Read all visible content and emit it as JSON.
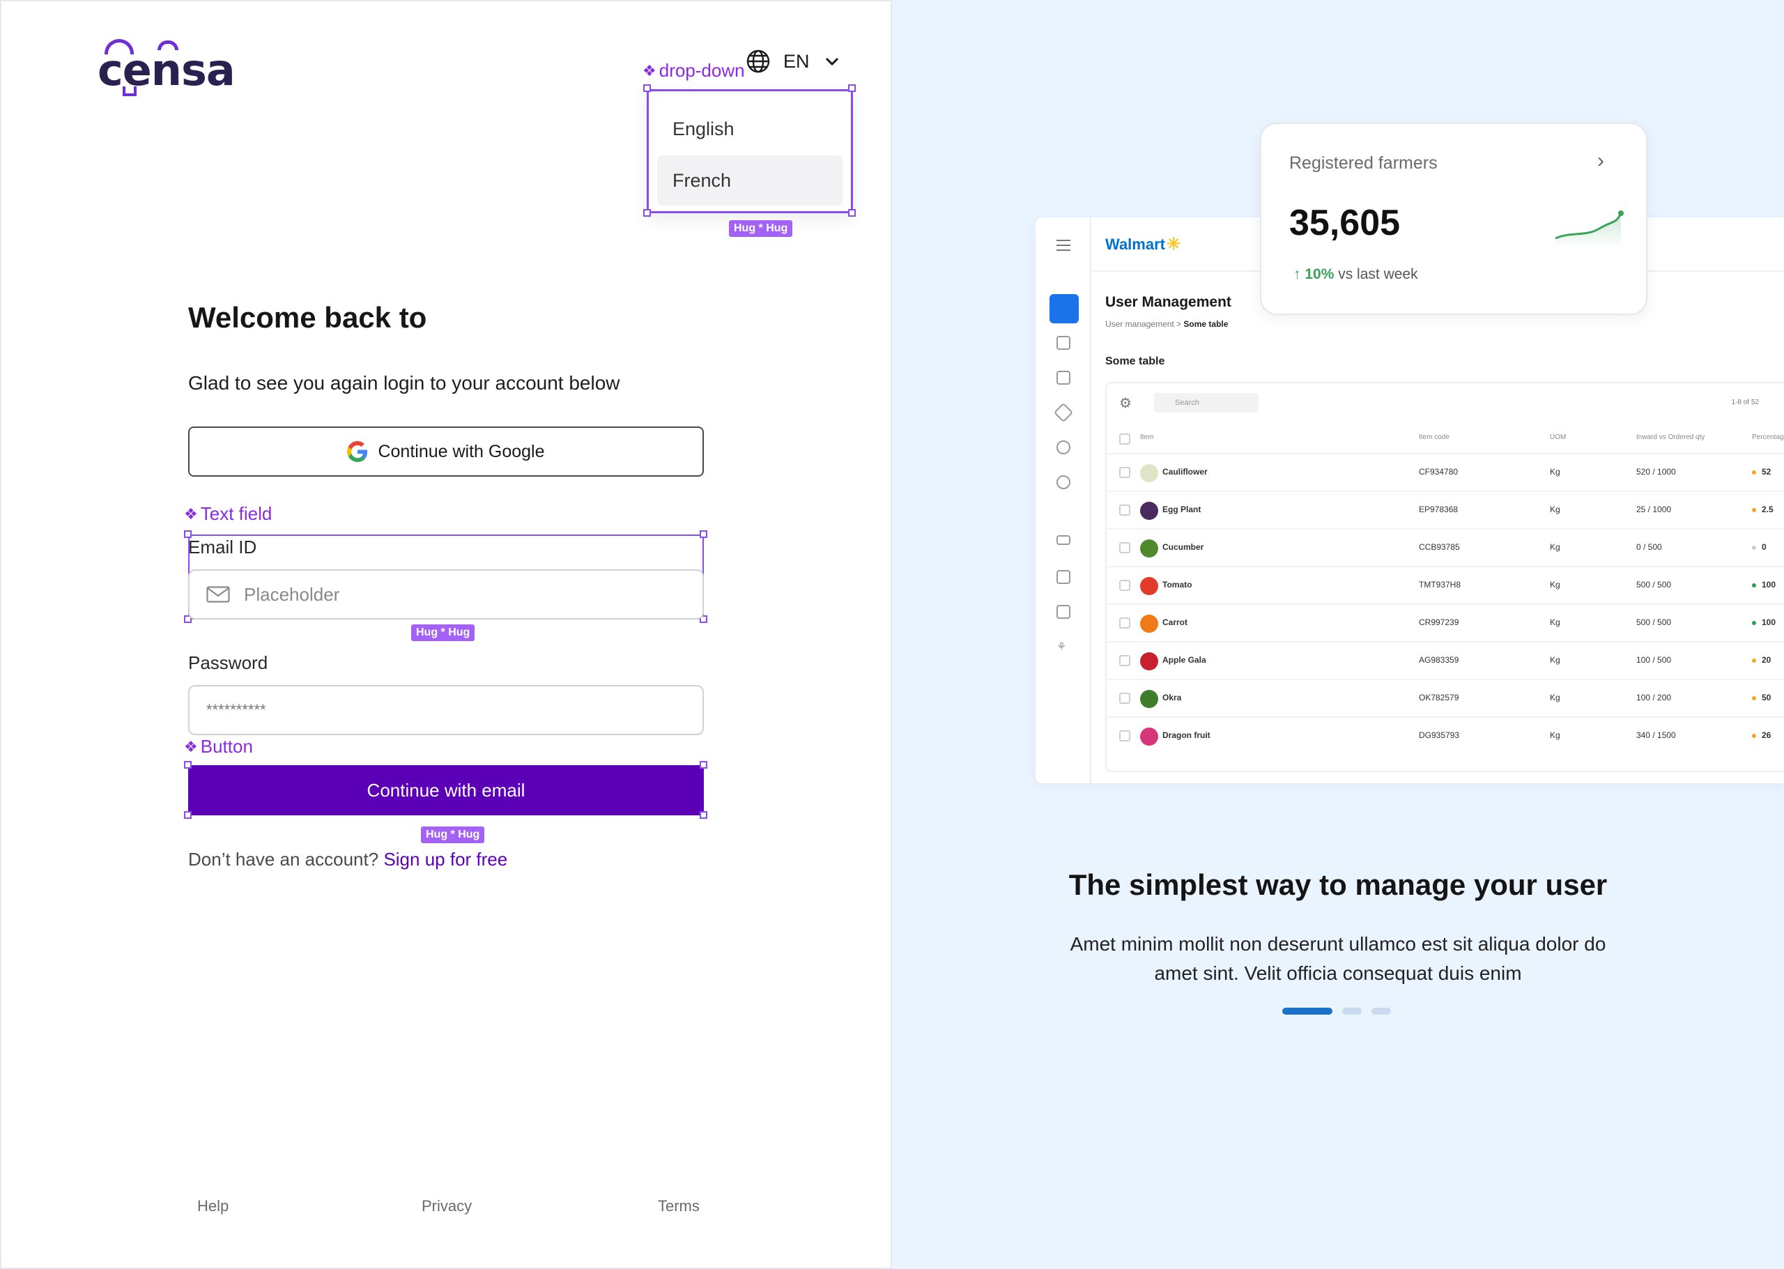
{
  "brand": {
    "logo_text": "censa"
  },
  "language": {
    "current": "EN",
    "component_label": "drop-down",
    "options": [
      "English",
      "French"
    ],
    "selected": "French",
    "hug_tag": "Hug * Hug"
  },
  "form": {
    "welcome": "Welcome back to",
    "subtitle": "Glad to see you again login to your account below",
    "google_button": "Continue with Google",
    "text_field_component": "Text field",
    "email_label": "Email ID",
    "email_placeholder": "Placeholder",
    "email_hug_tag": "Hug * Hug",
    "password_label": "Password",
    "password_value": "**********",
    "button_component": "Button",
    "submit_button": "Continue with email",
    "button_hug_tag": "Hug * Hug",
    "signup_prompt": "Don’t have an account?",
    "signup_link": "Sign up for free"
  },
  "footer": {
    "help": "Help",
    "privacy": "Privacy",
    "terms": "Terms"
  },
  "preview": {
    "brand": "Walmart",
    "page_title": "User Management",
    "breadcrumb_root": "User management >",
    "breadcrumb_current": "Some table",
    "table_title": "Some table",
    "search_placeholder": "Search",
    "pager": "1-8 of 52",
    "columns": [
      "Item",
      "Item code",
      "UOM",
      "Inward vs Ordered qty",
      "Percentag"
    ],
    "rows": [
      {
        "item": "Cauliflower",
        "code": "CF934780",
        "uom": "Kg",
        "qty": "520 / 1000",
        "pct": "52",
        "status": "#f5a623",
        "thumb": "#dfe6c8"
      },
      {
        "item": "Egg Plant",
        "code": "EP978368",
        "uom": "Kg",
        "qty": "25 / 1000",
        "pct": "2.5",
        "status": "#f5a623",
        "thumb": "#4a2b5e"
      },
      {
        "item": "Cucumber",
        "code": "CCB93785",
        "uom": "Kg",
        "qty": "0 / 500",
        "pct": "0",
        "status": "#cccccc",
        "thumb": "#4f8a2c"
      },
      {
        "item": "Tomato",
        "code": "TMT937H8",
        "uom": "Kg",
        "qty": "500 / 500",
        "pct": "100",
        "status": "#2e9e4f",
        "thumb": "#e23b2a"
      },
      {
        "item": "Carrot",
        "code": "CR997239",
        "uom": "Kg",
        "qty": "500 / 500",
        "pct": "100",
        "status": "#2e9e4f",
        "thumb": "#f07a1a"
      },
      {
        "item": "Apple Gala",
        "code": "AG983359",
        "uom": "Kg",
        "qty": "100 / 500",
        "pct": "20",
        "status": "#f5a623",
        "thumb": "#c8202e"
      },
      {
        "item": "Okra",
        "code": "OK782579",
        "uom": "Kg",
        "qty": "100 / 200",
        "pct": "50",
        "status": "#f5a623",
        "thumb": "#3e7d2a"
      },
      {
        "item": "Dragon fruit",
        "code": "DG935793",
        "uom": "Kg",
        "qty": "340 / 1500",
        "pct": "26",
        "status": "#f5a623",
        "thumb": "#d8367a"
      }
    ]
  },
  "stat_card": {
    "title": "Registered farmers",
    "value": "35,605",
    "delta": "10%",
    "delta_suffix": "vs last week"
  },
  "marketing": {
    "tagline": "The simplest way to manage your  user",
    "body": "Amet minim mollit non deserunt ullamco est sit aliqua dolor do amet sint. Velit officia consequat duis enim",
    "carousel_active_index": 0,
    "carousel_count": 3
  },
  "colors": {
    "primary": "#5c00b8",
    "annotation": "#8a2be2",
    "panel_bg": "#eaf4fe",
    "accent_blue": "#1a73c8",
    "positive": "#3aa35a"
  }
}
